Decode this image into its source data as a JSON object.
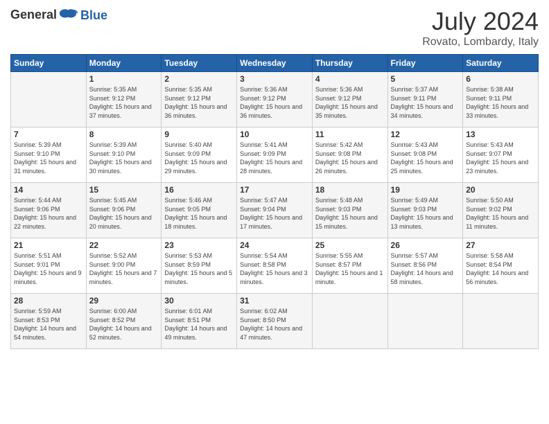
{
  "header": {
    "logo_general": "General",
    "logo_blue": "Blue",
    "title": "July 2024",
    "location": "Rovato, Lombardy, Italy"
  },
  "calendar": {
    "days": [
      "Sunday",
      "Monday",
      "Tuesday",
      "Wednesday",
      "Thursday",
      "Friday",
      "Saturday"
    ],
    "weeks": [
      [
        {
          "date": "",
          "content": ""
        },
        {
          "date": "1",
          "content": "Sunrise: 5:35 AM\nSunset: 9:12 PM\nDaylight: 15 hours\nand 37 minutes."
        },
        {
          "date": "2",
          "content": "Sunrise: 5:35 AM\nSunset: 9:12 PM\nDaylight: 15 hours\nand 36 minutes."
        },
        {
          "date": "3",
          "content": "Sunrise: 5:36 AM\nSunset: 9:12 PM\nDaylight: 15 hours\nand 36 minutes."
        },
        {
          "date": "4",
          "content": "Sunrise: 5:36 AM\nSunset: 9:12 PM\nDaylight: 15 hours\nand 35 minutes."
        },
        {
          "date": "5",
          "content": "Sunrise: 5:37 AM\nSunset: 9:11 PM\nDaylight: 15 hours\nand 34 minutes."
        },
        {
          "date": "6",
          "content": "Sunrise: 5:38 AM\nSunset: 9:11 PM\nDaylight: 15 hours\nand 33 minutes."
        }
      ],
      [
        {
          "date": "7",
          "content": "Sunrise: 5:39 AM\nSunset: 9:10 PM\nDaylight: 15 hours\nand 31 minutes."
        },
        {
          "date": "8",
          "content": "Sunrise: 5:39 AM\nSunset: 9:10 PM\nDaylight: 15 hours\nand 30 minutes."
        },
        {
          "date": "9",
          "content": "Sunrise: 5:40 AM\nSunset: 9:09 PM\nDaylight: 15 hours\nand 29 minutes."
        },
        {
          "date": "10",
          "content": "Sunrise: 5:41 AM\nSunset: 9:09 PM\nDaylight: 15 hours\nand 28 minutes."
        },
        {
          "date": "11",
          "content": "Sunrise: 5:42 AM\nSunset: 9:08 PM\nDaylight: 15 hours\nand 26 minutes."
        },
        {
          "date": "12",
          "content": "Sunrise: 5:43 AM\nSunset: 9:08 PM\nDaylight: 15 hours\nand 25 minutes."
        },
        {
          "date": "13",
          "content": "Sunrise: 5:43 AM\nSunset: 9:07 PM\nDaylight: 15 hours\nand 23 minutes."
        }
      ],
      [
        {
          "date": "14",
          "content": "Sunrise: 5:44 AM\nSunset: 9:06 PM\nDaylight: 15 hours\nand 22 minutes."
        },
        {
          "date": "15",
          "content": "Sunrise: 5:45 AM\nSunset: 9:06 PM\nDaylight: 15 hours\nand 20 minutes."
        },
        {
          "date": "16",
          "content": "Sunrise: 5:46 AM\nSunset: 9:05 PM\nDaylight: 15 hours\nand 18 minutes."
        },
        {
          "date": "17",
          "content": "Sunrise: 5:47 AM\nSunset: 9:04 PM\nDaylight: 15 hours\nand 17 minutes."
        },
        {
          "date": "18",
          "content": "Sunrise: 5:48 AM\nSunset: 9:03 PM\nDaylight: 15 hours\nand 15 minutes."
        },
        {
          "date": "19",
          "content": "Sunrise: 5:49 AM\nSunset: 9:03 PM\nDaylight: 15 hours\nand 13 minutes."
        },
        {
          "date": "20",
          "content": "Sunrise: 5:50 AM\nSunset: 9:02 PM\nDaylight: 15 hours\nand 11 minutes."
        }
      ],
      [
        {
          "date": "21",
          "content": "Sunrise: 5:51 AM\nSunset: 9:01 PM\nDaylight: 15 hours\nand 9 minutes."
        },
        {
          "date": "22",
          "content": "Sunrise: 5:52 AM\nSunset: 9:00 PM\nDaylight: 15 hours\nand 7 minutes."
        },
        {
          "date": "23",
          "content": "Sunrise: 5:53 AM\nSunset: 8:59 PM\nDaylight: 15 hours\nand 5 minutes."
        },
        {
          "date": "24",
          "content": "Sunrise: 5:54 AM\nSunset: 8:58 PM\nDaylight: 15 hours\nand 3 minutes."
        },
        {
          "date": "25",
          "content": "Sunrise: 5:55 AM\nSunset: 8:57 PM\nDaylight: 15 hours\nand 1 minute."
        },
        {
          "date": "26",
          "content": "Sunrise: 5:57 AM\nSunset: 8:56 PM\nDaylight: 14 hours\nand 58 minutes."
        },
        {
          "date": "27",
          "content": "Sunrise: 5:58 AM\nSunset: 8:54 PM\nDaylight: 14 hours\nand 56 minutes."
        }
      ],
      [
        {
          "date": "28",
          "content": "Sunrise: 5:59 AM\nSunset: 8:53 PM\nDaylight: 14 hours\nand 54 minutes."
        },
        {
          "date": "29",
          "content": "Sunrise: 6:00 AM\nSunset: 8:52 PM\nDaylight: 14 hours\nand 52 minutes."
        },
        {
          "date": "30",
          "content": "Sunrise: 6:01 AM\nSunset: 8:51 PM\nDaylight: 14 hours\nand 49 minutes."
        },
        {
          "date": "31",
          "content": "Sunrise: 6:02 AM\nSunset: 8:50 PM\nDaylight: 14 hours\nand 47 minutes."
        },
        {
          "date": "",
          "content": ""
        },
        {
          "date": "",
          "content": ""
        },
        {
          "date": "",
          "content": ""
        }
      ]
    ]
  }
}
